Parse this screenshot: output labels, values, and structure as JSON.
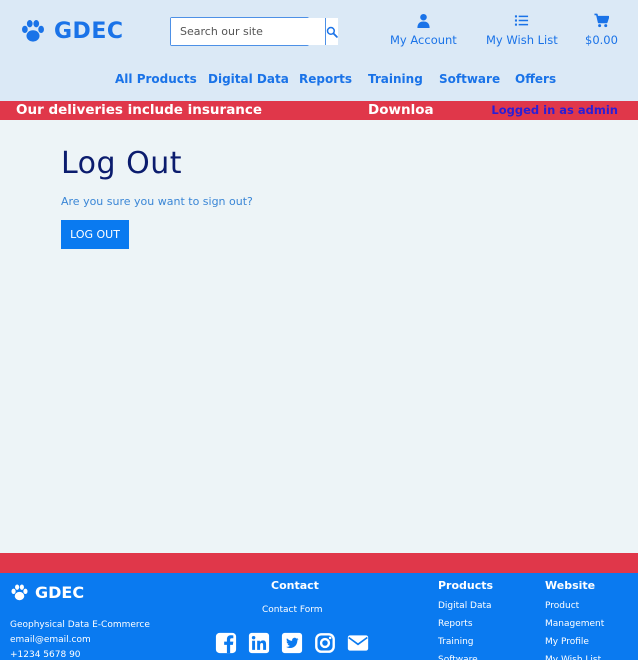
{
  "brand": {
    "name": "GDEC",
    "color": "#1a73e8"
  },
  "search": {
    "placeholder": "Search our site"
  },
  "header_links": {
    "account": "My Account",
    "wishlist": "My Wish List",
    "cart": "$0.00"
  },
  "nav": [
    "All Products",
    "Digital Data",
    "Reports",
    "Training",
    "Software",
    "Offers"
  ],
  "ticker": {
    "text_a": "Our deliveries include insurance",
    "text_b": "Downloa",
    "logged_in": "Logged in as admin"
  },
  "main": {
    "title": "Log Out",
    "message": "Are you sure you want to sign out?",
    "button": "LOG OUT"
  },
  "footer": {
    "brand": "GDEC",
    "company": "Geophysical Data E-Commerce",
    "email": "email@email.com",
    "phone": "+1234 5678 90",
    "contact_heading": "Contact",
    "contact_form": "Contact Form",
    "socials": [
      "facebook-icon",
      "linkedin-icon",
      "twitter-icon",
      "instagram-icon",
      "envelope-icon"
    ],
    "products_heading": "Products",
    "products": [
      "Digital Data",
      "Reports",
      "Training",
      "Software"
    ],
    "website_heading": "Website",
    "website": [
      "Product",
      "Management",
      "My Profile",
      "My Wish List"
    ]
  },
  "colors": {
    "accent": "#1a73e8",
    "ticker": "#e0374a",
    "footer": "#0a7af0",
    "title": "#0b1c6e"
  }
}
